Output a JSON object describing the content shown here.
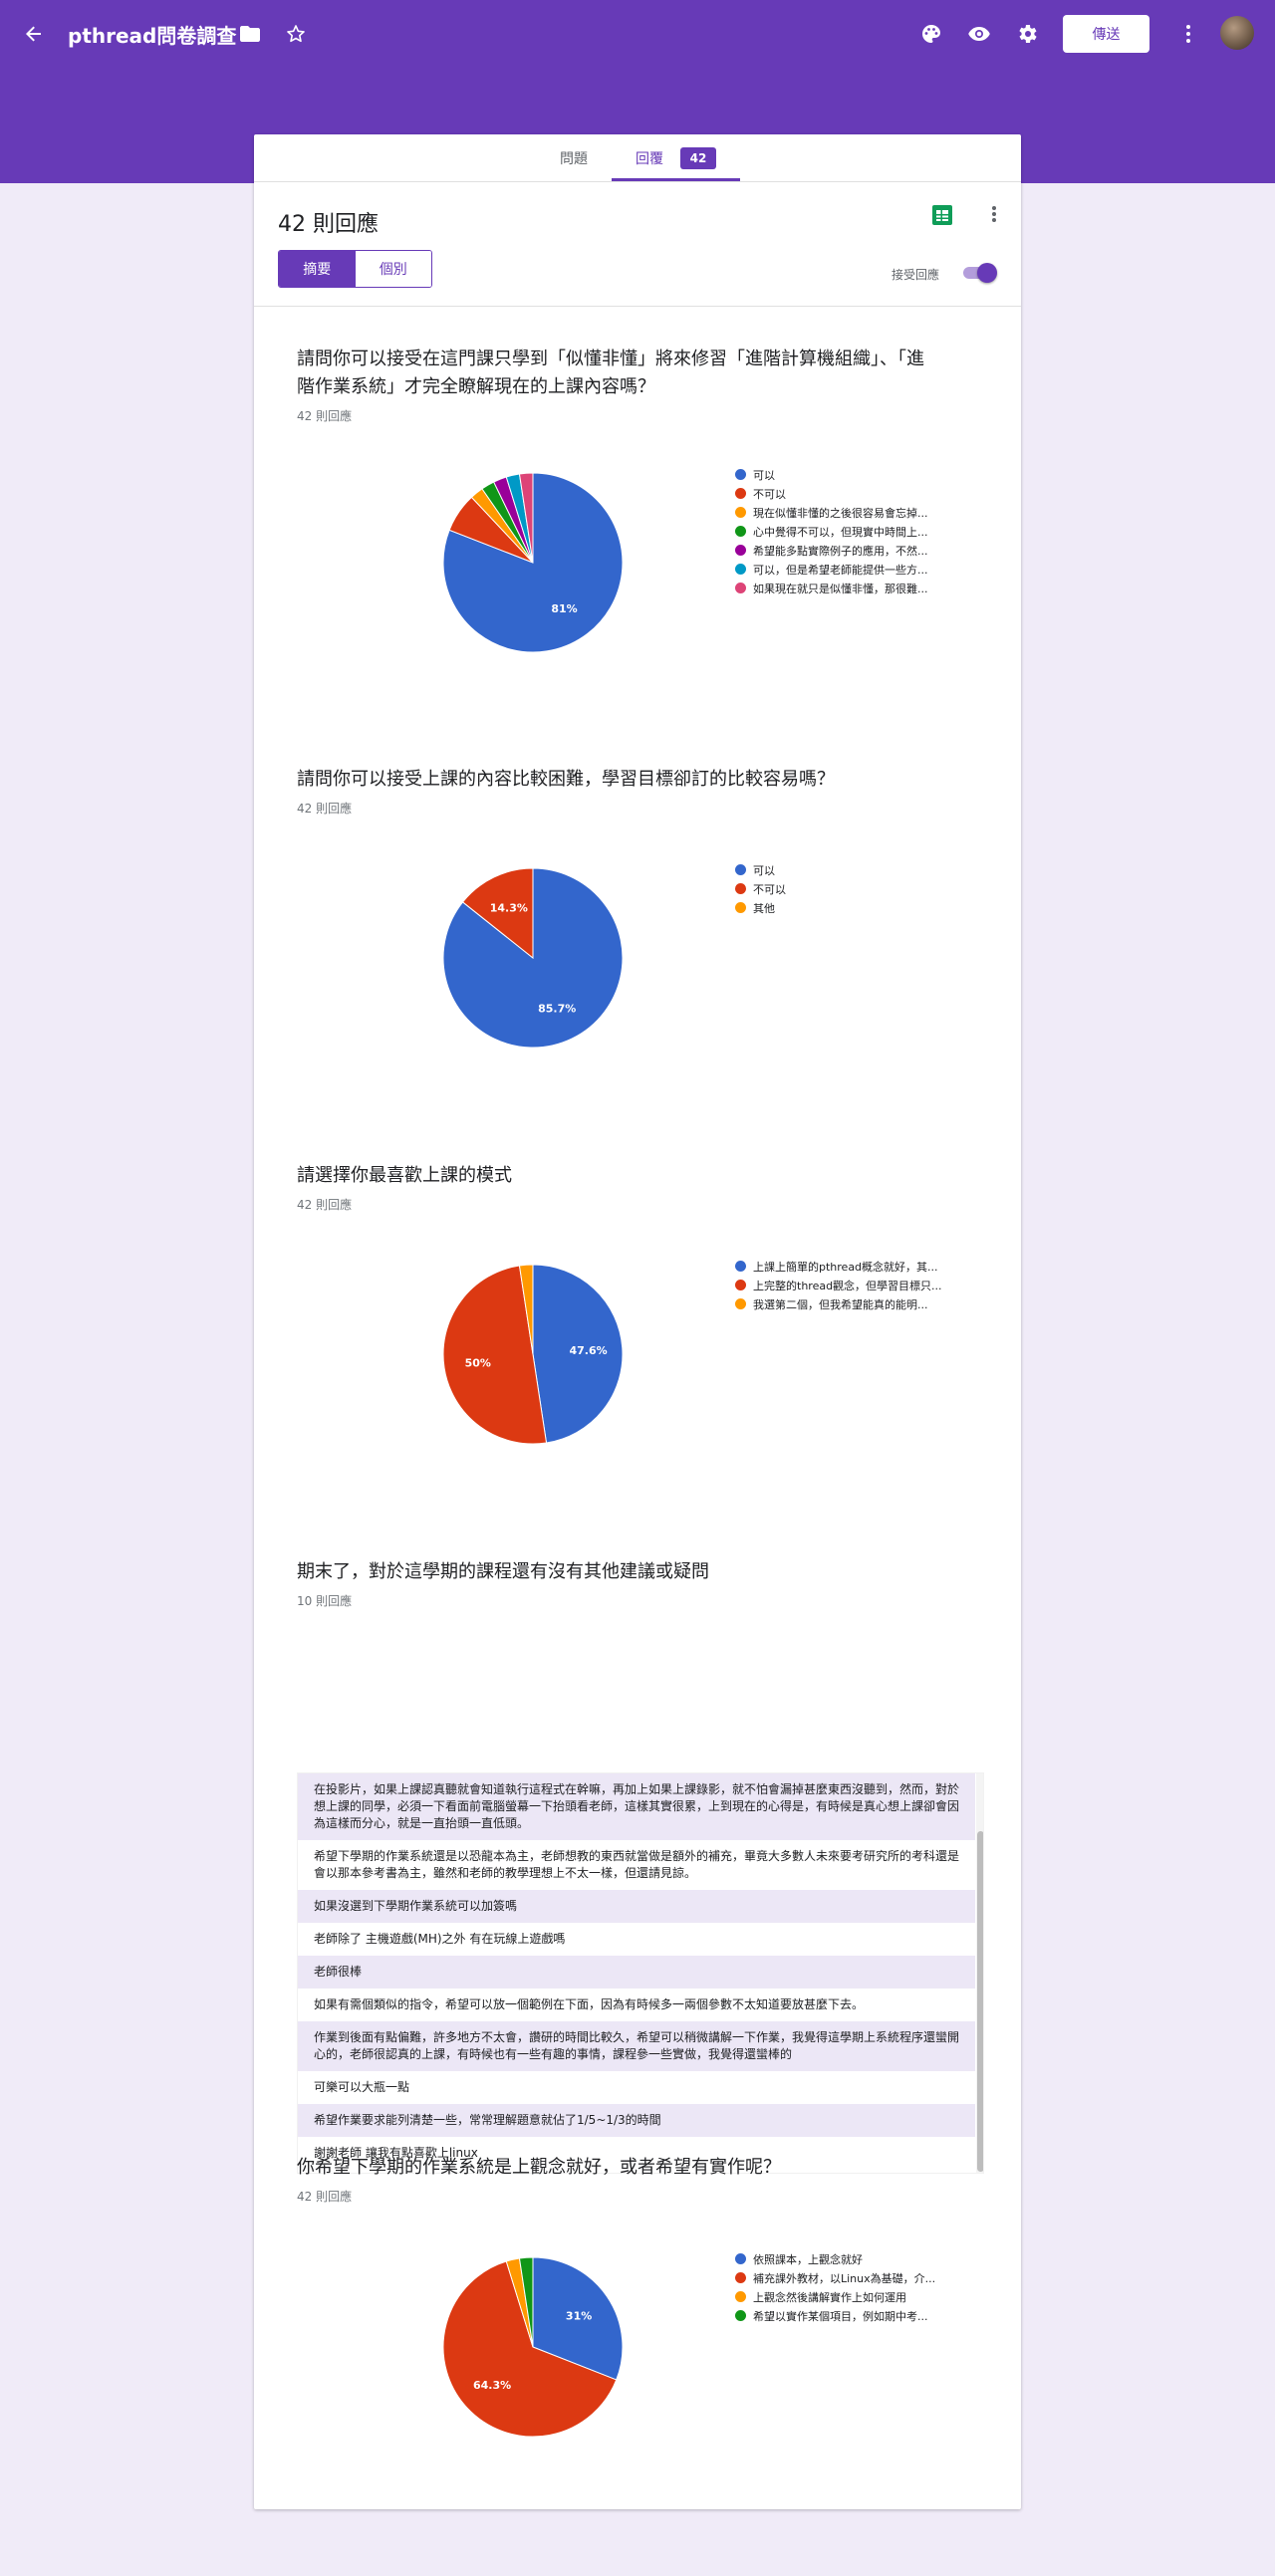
{
  "header": {
    "title": "pthread問卷調查",
    "send_label": "傳送",
    "bar_color": "#673ab7"
  },
  "tabs": [
    {
      "label": "問題"
    },
    {
      "label": "回覆",
      "badge": "42"
    }
  ],
  "responses": {
    "title": "42 則回應",
    "view_summary": "摘要",
    "view_individual": "個別",
    "accepting_label": "接受回應"
  },
  "questions": [
    {
      "title": "請問你可以接受在這門課只學到「似懂非懂」將來修習「進階計算機組織」、「進階作業系統」才完全瞭解現在的上課內容嗎？",
      "count": "42 則回應",
      "legend": [
        "可以",
        "不可以",
        "現在似懂非懂的之後很容易會忘掉...",
        "心中覺得不可以，但現實中時間上...",
        "希望能多點實際例子的應用，不然...",
        "可以，但是希望老師能提供一些方...",
        "如果現在就只是似懂非懂，那很難..."
      ]
    },
    {
      "title": "請問你可以接受上課的內容比較困難，學習目標卻訂的比較容易嗎？",
      "count": "42 則回應",
      "legend": [
        "可以",
        "不可以",
        "其他"
      ]
    },
    {
      "title": "請選擇你最喜歡上課的模式",
      "count": "42 則回應",
      "legend": [
        "上課上簡單的pthread概念就好，其...",
        "上完整的thread觀念，但學習目標只...",
        "我選第二個，但我希望能真的能明..."
      ]
    },
    {
      "title": "期末了，對於這學期的課程還有沒有其他建議或疑問",
      "count": "10 則回應",
      "rows": [
        "在投影片，如果上課認真聽就會知道執行這程式在幹嘛，再加上如果上課錄影，就不怕會漏掉甚麼東西沒聽到，然而，對於想上課的同學，必須一下看面前電腦螢幕一下抬頭看老師，這樣其實很累，上到現在的心得是，有時候是真心想上課卻會因為這樣而分心，就是一直抬頭一直低頭。",
        "希望下學期的作業系統還是以恐龍本為主，老師想教的東西就當做是額外的補充，畢竟大多數人未來要考研究所的考科還是會以那本參考書為主，雖然和老師的教學理想上不太一樣，但還請見諒。",
        "如果沒選到下學期作業系統可以加簽嗎",
        "老師除了 主機遊戲(MH)之外 有在玩線上遊戲嗎",
        "老師很棒",
        "如果有需個類似的指令，希望可以放一個範例在下面，因為有時候多一兩個參數不太知道要放甚麼下去。",
        "作業到後面有點偏難，許多地方不太會，讚研的時間比較久，希望可以稍微講解一下作業，我覺得這學期上系統程序還蠻開心的，老師很認真的上課，有時候也有一些有趣的事情，課程參一些實做，我覺得還蠻棒的",
        "可樂可以大瓶一點",
        "希望作業要求能列清楚一些，常常理解題意就佔了1/5~1/3的時間",
        "謝謝老師 讓我有點喜歡上linux"
      ]
    },
    {
      "title": "你希望下學期的作業系統是上觀念就好，或者希望有實作呢？",
      "count": "42 則回應",
      "legend": [
        "依照課本，上觀念就好",
        "補充課外教材，以Linux為基礎，介...",
        "上觀念然後講解實作上如何運用",
        "希望以實作某個項目，例如期中考..."
      ]
    }
  ],
  "chart_data": [
    {
      "type": "pie",
      "labels": [
        "可以",
        "不可以",
        "現在似懂非懂的之後很容易會忘掉...",
        "心中覺得不可以，但現實中時間上...",
        "希望能多點實際例子的應用，不然...",
        "可以，但是希望老師能提供一些方...",
        "如果現在就只是似懂非懂，那很難..."
      ],
      "values": [
        81,
        7.1,
        2.4,
        2.4,
        2.4,
        2.4,
        2.4
      ],
      "colors": [
        "#3366cc",
        "#dc3912",
        "#ff9900",
        "#109618",
        "#990099",
        "#0099c6",
        "#dd4477"
      ],
      "data_labels": [
        "81%",
        "",
        "",
        "",
        "",
        "",
        ""
      ]
    },
    {
      "type": "pie",
      "labels": [
        "可以",
        "不可以",
        "其他"
      ],
      "values": [
        85.7,
        14.3,
        0
      ],
      "colors": [
        "#3366cc",
        "#dc3912",
        "#ff9900"
      ],
      "data_labels": [
        "85.7%",
        "14.3%",
        ""
      ]
    },
    {
      "type": "pie",
      "labels": [
        "上課上簡單的pthread概念就好，其...",
        "上完整的thread觀念，但學習目標只...",
        "我選第二個，但我希望能真的能明..."
      ],
      "values": [
        47.6,
        50,
        2.4
      ],
      "colors": [
        "#3366cc",
        "#dc3912",
        "#ff9900"
      ],
      "data_labels": [
        "47.6%",
        "50%",
        ""
      ]
    },
    {
      "type": "pie",
      "labels": [
        "依照課本，上觀念就好",
        "補充課外教材，以Linux為基礎，介...",
        "上觀念然後講解實作上如何運用",
        "希望以實作某個項目，例如期中考..."
      ],
      "values": [
        31,
        64.3,
        2.4,
        2.4
      ],
      "colors": [
        "#3366cc",
        "#dc3912",
        "#ff9900",
        "#109618"
      ],
      "data_labels": [
        "31%",
        "64.3%",
        "",
        ""
      ]
    }
  ]
}
